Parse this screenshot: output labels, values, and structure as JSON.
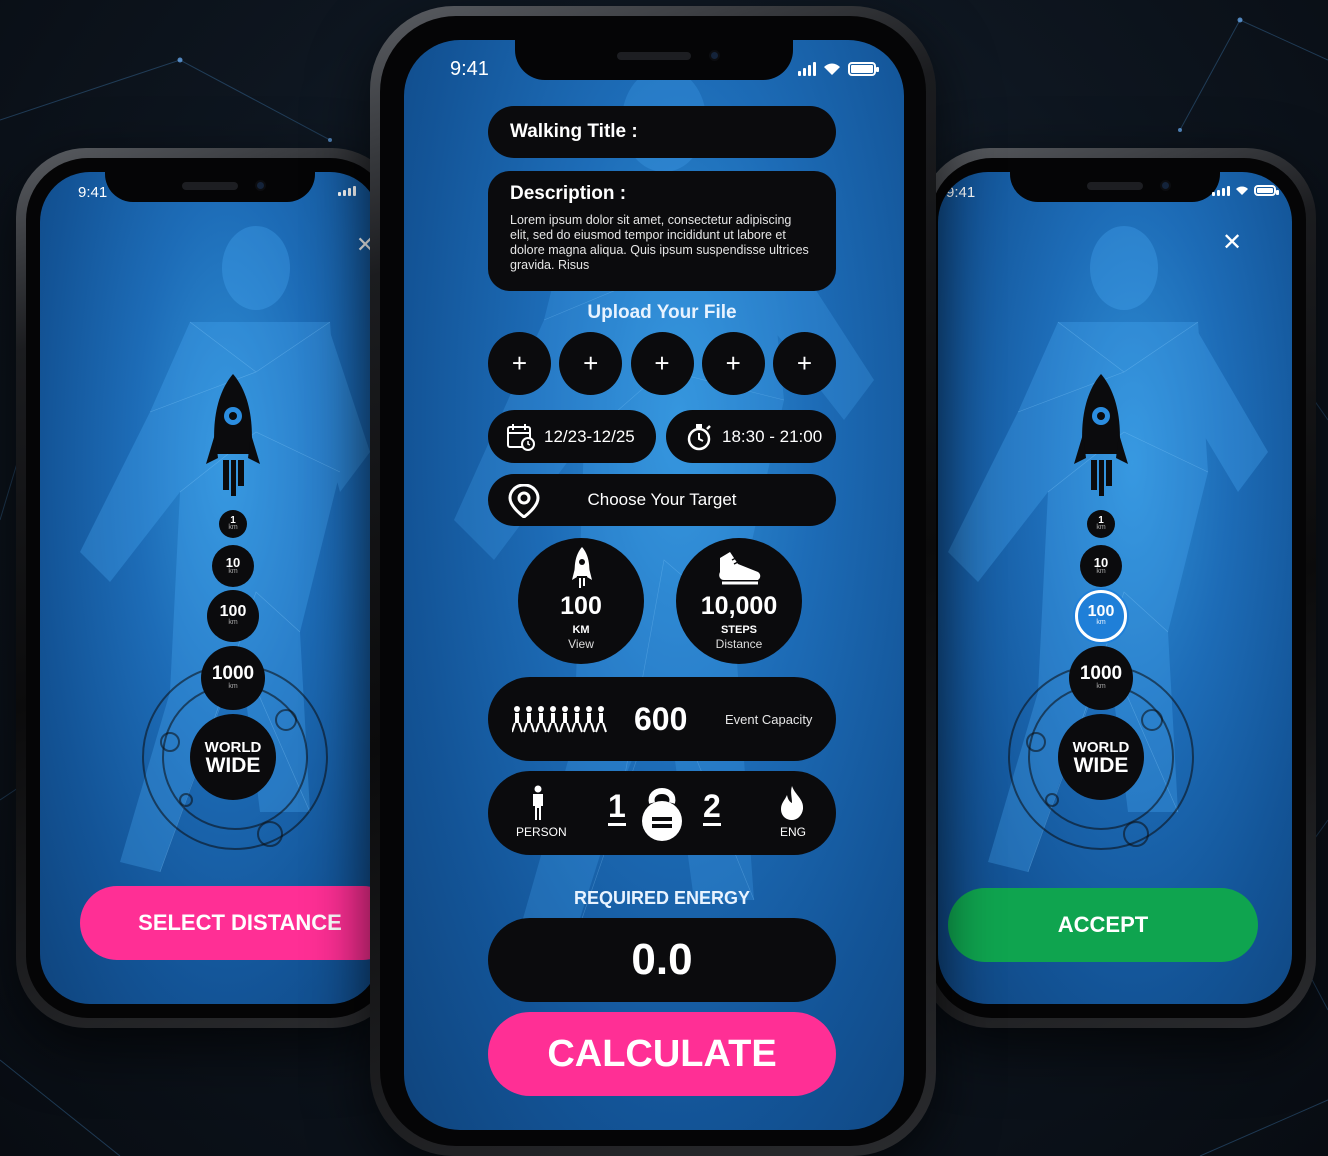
{
  "left_phone": {
    "time": "9:41",
    "distances": [
      {
        "value": "1",
        "unit": "km"
      },
      {
        "value": "10",
        "unit": "km"
      },
      {
        "value": "100",
        "unit": "km"
      },
      {
        "value": "1000",
        "unit": "km"
      }
    ],
    "world_line1": "WORLD",
    "world_line2": "WIDE",
    "button_label": "SELECT DISTANCE",
    "button_color": "#ff2f95"
  },
  "center_phone": {
    "time": "9:41",
    "walking_title_label": "Walking Title :",
    "description_label": "Description :",
    "description_text": "Lorem ipsum dolor sit amet, consectetur adipiscing elit, sed do eiusmod tempor incididunt ut labore et dolore magna aliqua. Quis ipsum suspendisse ultrices gravida. Risus",
    "upload_title": "Upload Your File",
    "upload_buttons": [
      "+",
      "+",
      "+",
      "+",
      "+"
    ],
    "date_range": "12/23-12/25",
    "time_range": "18:30 - 21:00",
    "target_label": "Choose Your Target",
    "distance_stat": {
      "value": "100",
      "unit": "KM",
      "caption": "View"
    },
    "steps_stat": {
      "value": "10,000",
      "unit": "STEPS",
      "caption": "Distance"
    },
    "capacity": {
      "value": "600",
      "label": "Event Capacity"
    },
    "level": {
      "person_label": "PERSON",
      "left_num": "1",
      "right_num": "2",
      "energy_label": "ENG"
    },
    "required_energy_label": "REQUIRED ENERGY",
    "energy_value": "0.0",
    "calculate_label": "CALCULATE",
    "accent_color": "#ff2f95"
  },
  "right_phone": {
    "time": "9:41",
    "distances": [
      {
        "value": "1",
        "unit": "km"
      },
      {
        "value": "10",
        "unit": "km"
      },
      {
        "value": "100",
        "unit": "km",
        "selected": true
      },
      {
        "value": "1000",
        "unit": "km"
      }
    ],
    "world_line1": "WORLD",
    "world_line2": "WIDE",
    "button_label": "ACCEPT",
    "button_color": "#0fa44f"
  }
}
